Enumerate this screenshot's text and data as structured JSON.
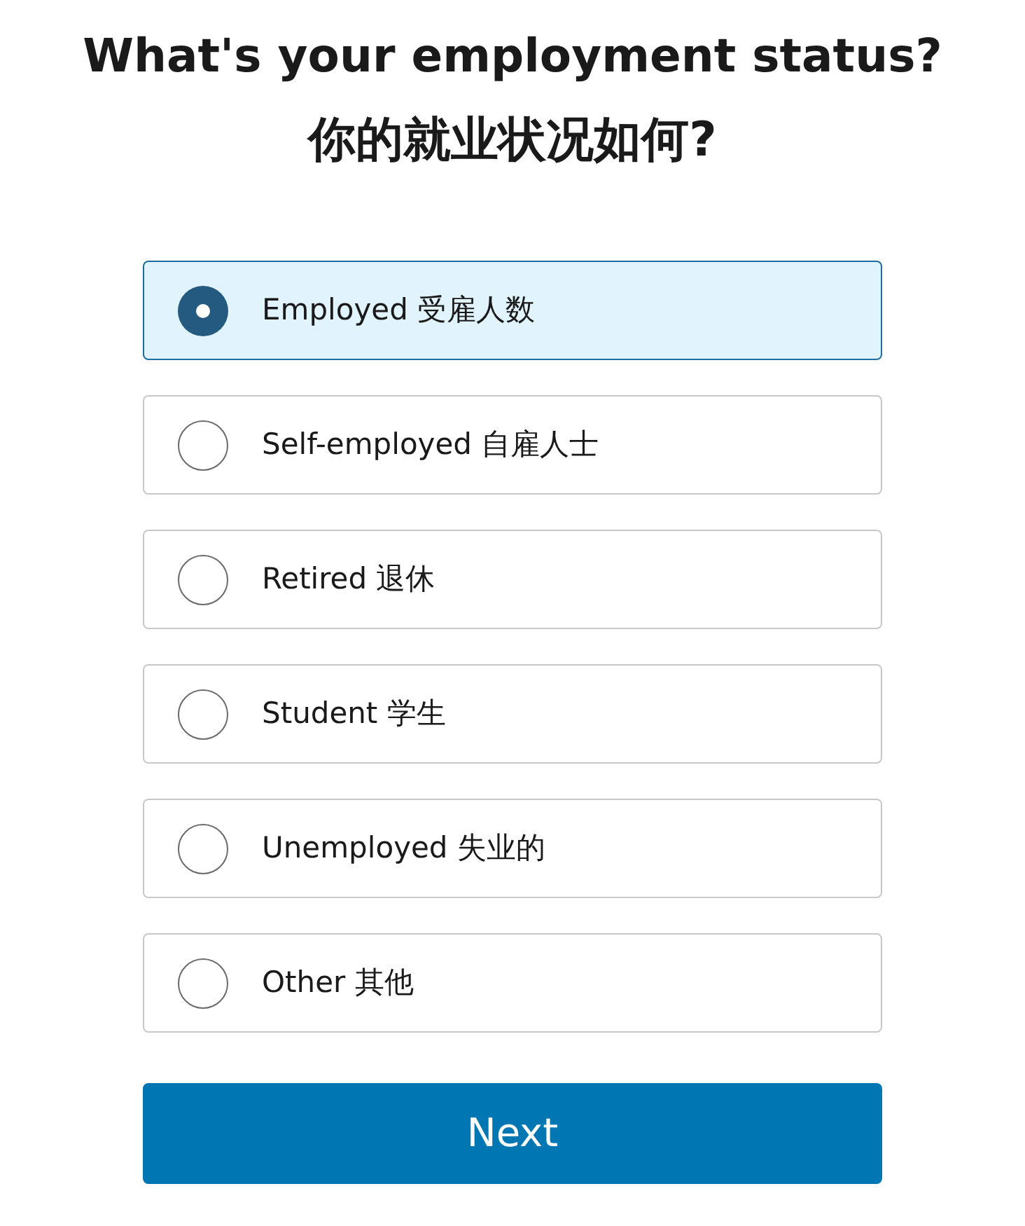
{
  "title": "What's your employment status?",
  "subtitle": "你的就业状况如何?",
  "options": [
    {
      "label": "Employed 受雇人数",
      "selected": true
    },
    {
      "label": "Self-employed 自雇人士",
      "selected": false
    },
    {
      "label": "Retired 退休",
      "selected": false
    },
    {
      "label": "Student 学生",
      "selected": false
    },
    {
      "label": "Unemployed 失业的",
      "selected": false
    },
    {
      "label": "Other 其他",
      "selected": false
    }
  ],
  "button": "Next"
}
